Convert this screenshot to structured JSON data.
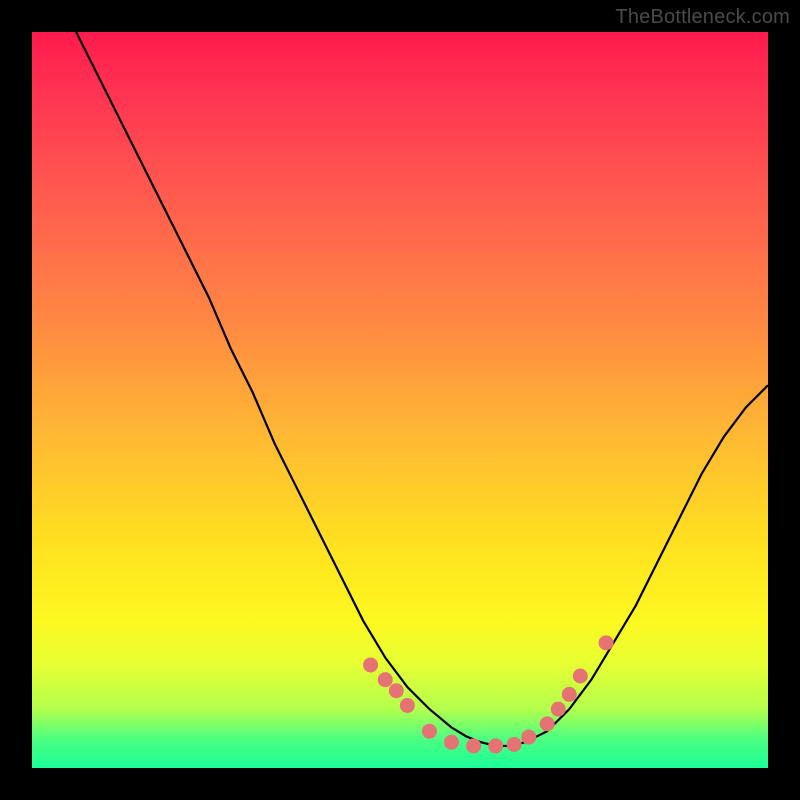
{
  "watermark": "TheBottleneck.com",
  "colors": {
    "curve_stroke": "#000000",
    "marker_fill": "#e57373",
    "marker_stroke": "#e57373"
  },
  "chart_data": {
    "type": "line",
    "title": "",
    "xlabel": "",
    "ylabel": "",
    "xlim": [
      0,
      100
    ],
    "ylim": [
      0,
      100
    ],
    "x": [
      0,
      3,
      6,
      9,
      12,
      15,
      18,
      21,
      24,
      27,
      30,
      33,
      36,
      39,
      42,
      45,
      48,
      51,
      54,
      57,
      59,
      61,
      63,
      65,
      67,
      70,
      73,
      76,
      79,
      82,
      85,
      88,
      91,
      94,
      97,
      100
    ],
    "values": [
      108,
      105,
      100,
      94,
      88,
      82,
      76,
      70,
      64,
      57,
      51,
      44,
      38,
      32,
      26,
      20,
      15,
      11,
      8,
      5.5,
      4.3,
      3.5,
      3,
      3,
      3.5,
      5,
      8,
      12,
      17,
      22,
      28,
      34,
      40,
      45,
      49,
      52
    ],
    "markers": {
      "x": [
        46,
        48,
        49.5,
        51,
        54,
        57,
        60,
        63,
        65.5,
        67.5,
        70,
        71.5,
        73,
        74.5,
        78
      ],
      "y": [
        14,
        12,
        10.5,
        8.5,
        5,
        3.5,
        3,
        3,
        3.2,
        4.2,
        6,
        8,
        10,
        12.5,
        17
      ]
    }
  }
}
